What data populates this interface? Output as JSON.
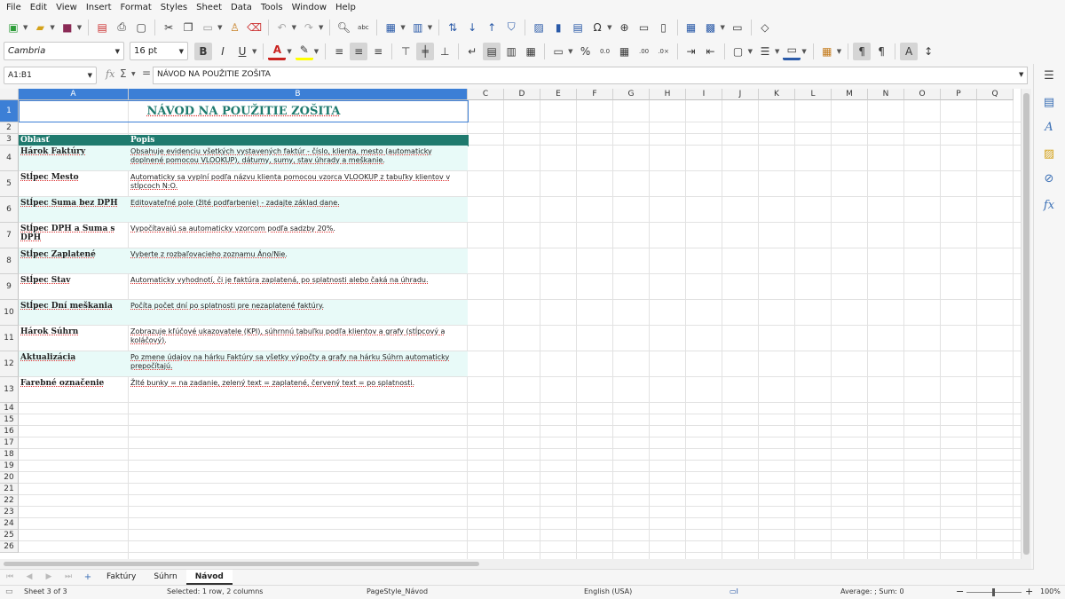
{
  "menu": [
    "File",
    "Edit",
    "View",
    "Insert",
    "Format",
    "Styles",
    "Sheet",
    "Data",
    "Tools",
    "Window",
    "Help"
  ],
  "font": {
    "name": "Cambria",
    "size": "16 pt"
  },
  "formula_bar": {
    "cell_ref": "A1:B1",
    "content": "NÁVOD NA POUŽITIE ZOŠITA",
    "fx": "fx",
    "sum": "Σ",
    "eq": "="
  },
  "columns": [
    "A",
    "B",
    "C",
    "D",
    "E",
    "F",
    "G",
    "H",
    "I",
    "J",
    "K",
    "L",
    "M",
    "N",
    "O",
    "P",
    "Q"
  ],
  "rows": [
    "1",
    "2",
    "3",
    "4",
    "5",
    "6",
    "7",
    "8",
    "9",
    "10",
    "11",
    "12",
    "13",
    "14",
    "15",
    "16",
    "17",
    "18",
    "19",
    "20",
    "21",
    "22",
    "23",
    "24",
    "25",
    "26"
  ],
  "sheet": {
    "title": "NÁVOD NA POUŽITIE ZOŠITA",
    "header": {
      "a": "Oblasť",
      "b": "Popis"
    },
    "entries": [
      {
        "area": "Hárok Faktúry",
        "desc": "Obsahuje evidenciu všetkých vystavených faktúr - číslo, klienta, mesto (automaticky doplnené pomocou VLOOKUP), dátumy, sumy, stav úhrady a meškanie."
      },
      {
        "area": "Stĺpec Mesto",
        "desc": "Automaticky sa vyplní podľa názvu klienta pomocou vzorca VLOOKUP z tabuľky klientov v stĺpcoch N:O."
      },
      {
        "area": "Stĺpec Suma bez DPH",
        "desc": "Editovateľné pole (žlté podfarbenie) - zadajte základ dane."
      },
      {
        "area": "Stĺpec DPH a Suma s DPH",
        "desc": "Vypočítavajú sa automaticky vzorcom podľa sadzby 20%."
      },
      {
        "area": "Stĺpec Zaplatené",
        "desc": "Vyberte z rozbaľovacieho zoznamu Áno/Nie."
      },
      {
        "area": "Stĺpec Stav",
        "desc": "Automaticky vyhodnotí, či je faktúra zaplatená, po splatnosti alebo čaká na úhradu."
      },
      {
        "area": "Stĺpec Dní meškania",
        "desc": "Počíta počet dní po splatnosti pre nezaplatené faktúry."
      },
      {
        "area": "Hárok Súhrn",
        "desc": "Zobrazuje kľúčové ukazovatele (KPI), súhrnnú tabuľku podľa klientov a grafy (stĺpcový a koláčový)."
      },
      {
        "area": "Aktualizácia",
        "desc": "Po zmene údajov na hárku Faktúry sa všetky výpočty a grafy na hárku Súhrn automaticky prepočítajú."
      },
      {
        "area": "Farebné označenie",
        "desc": "Žlté bunky = na zadanie, zelený text = zaplatené, červený text = po splatnosti."
      }
    ]
  },
  "tabs": [
    "Faktúry",
    "Súhrn",
    "Návod"
  ],
  "active_tab": "Návod",
  "status": {
    "sheet": "Sheet 3 of 3",
    "selection": "Selected: 1 row, 2 columns",
    "page_style": "PageStyle_Návod",
    "language": "English (USA)",
    "sum": "Average: ; Sum: 0",
    "zoom": "100%"
  },
  "colors": {
    "header_fill": "#1f7a6e",
    "title_text": "#1f7a6e",
    "selection": "#3c7fd6",
    "row_tint": "#e8faf8"
  }
}
